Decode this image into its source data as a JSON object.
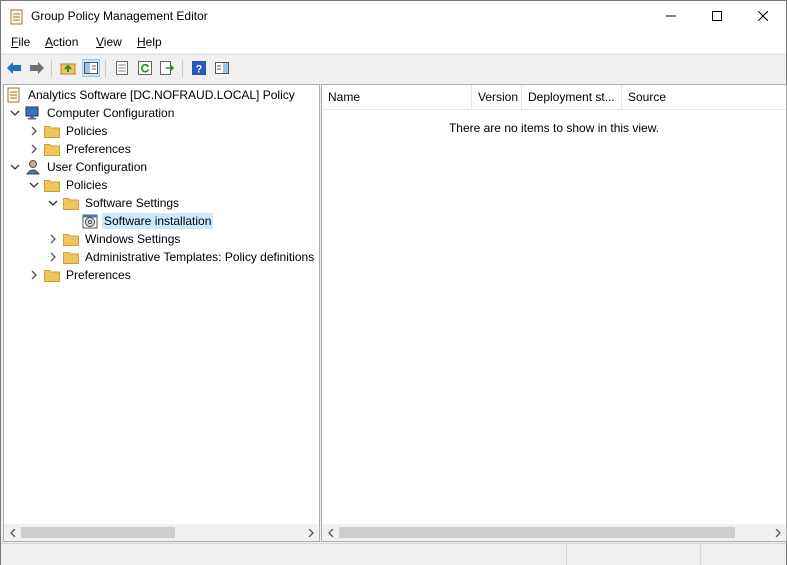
{
  "window": {
    "title": "Group Policy Management Editor",
    "controls": {
      "minimize": "minimize",
      "maximize": "maximize",
      "close": "close"
    }
  },
  "menu": [
    "File",
    "Action",
    "View",
    "Help"
  ],
  "menu_mnemonics": [
    "F",
    "A",
    "V",
    "H"
  ],
  "toolbar": [
    {
      "icon": "back-arrow-icon",
      "color": "#1a73c9"
    },
    {
      "icon": "forward-arrow-icon",
      "color": "#5e5e5e"
    },
    {
      "icon": "up-folder-icon"
    },
    {
      "icon": "show-hide-tree-icon",
      "pressed": true
    },
    {
      "icon": "properties-icon"
    },
    {
      "icon": "refresh-icon"
    },
    {
      "icon": "export-list-icon"
    },
    {
      "icon": "help-icon"
    },
    {
      "icon": "show-hide-action-pane-icon"
    }
  ],
  "tree": {
    "root": "Analytics Software [DC.NOFRAUD.LOCAL] Policy",
    "computer_config": "Computer Configuration",
    "cc_policies": "Policies",
    "cc_preferences": "Preferences",
    "user_config": "User Configuration",
    "uc_policies": "Policies",
    "software_settings": "Software Settings",
    "software_installation": "Software installation",
    "windows_settings": "Windows Settings",
    "admin_templates": "Administrative Templates: Policy definitions",
    "uc_preferences": "Preferences",
    "selected": "Software installation"
  },
  "list": {
    "columns": [
      "Name",
      "Version",
      "Deployment st...",
      "Source"
    ],
    "empty_message": "There are no items to show in this view."
  },
  "colors": {
    "selection": "#cce8ff",
    "folder": "#f2c55c",
    "accent": "#1a73c9"
  }
}
